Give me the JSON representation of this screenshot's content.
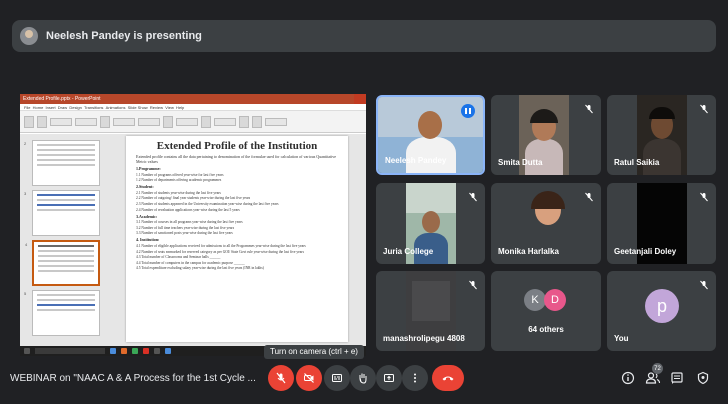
{
  "banner": {
    "presenting_text": "Neelesh Pandey is presenting"
  },
  "presentation": {
    "window_title": "Extended Profile.pptx - PowerPoint",
    "slide": {
      "title": "Extended Profile of the Institution",
      "intro": "Extended profile contains all the data pertaining to denomination of the formulae used for calculation of various Quantitative Metric values",
      "sections": [
        {
          "heading": "1.Programme:",
          "lines": [
            "1.1 Number of programs offered year-wise for last five years",
            "1.2 Number of departments offering academic programmes"
          ]
        },
        {
          "heading": "2.Student:",
          "lines": [
            "2.1 Number of students year-wise during the last five years",
            "2.2 Number of outgoing/ final year students year-wise during the last five years",
            "2.3 Number of students appeared in the University examination year-wise during the last five years",
            "2.4 Number of revaluation applications year-wise during the last 5 years"
          ]
        },
        {
          "heading": "3.Academic:",
          "lines": [
            "3.1 Number of courses in all programs year-wise during the last five years",
            "3.2 Number of full time teachers year-wise during the last five years",
            "3.3 Number of sanctioned posts year-wise during the last five years"
          ]
        },
        {
          "heading": "4. Institution:",
          "lines": [
            "4.1 Number of eligible applications received for admissions to all the Programmes year-wise during the last five years",
            "4.2 Number of seats earmarked for reserved category as per GOI/ State Govt rule year-wise during the last five years",
            "4.3 Total number of Classrooms and Seminar halls ______",
            "4.4 Total number of computers in the campus for academic purpose ______",
            "4.5 Total expenditure excluding salary year-wise during the last five years (INR in lakhs)"
          ]
        }
      ]
    }
  },
  "participants": [
    {
      "name": "Neelesh Pandey",
      "speaking": true
    },
    {
      "name": "Smita Dutta",
      "muted": true
    },
    {
      "name": "Ratul Saikia",
      "muted": true
    },
    {
      "name": "Juria College",
      "muted": true
    },
    {
      "name": "Monika Harlalka",
      "muted": true
    },
    {
      "name": "Geetanjali Doley",
      "muted": true
    },
    {
      "name": "manashrolipegu 4808",
      "muted": true
    },
    {
      "name": "64 others",
      "initials": [
        "K",
        "D"
      ]
    },
    {
      "name": "You",
      "initial": "p",
      "muted": true
    }
  ],
  "tooltip": "Turn on camera (ctrl + e)",
  "bottom_bar": {
    "meeting_title": "WEBINAR on \"NAAC A & A Process for the 1st Cycle ...",
    "participant_count": "72"
  },
  "colors": {
    "background": "#202124",
    "tile": "#3c4043",
    "danger": "#ea4335",
    "accent": "#8ab4f8"
  },
  "icons": {
    "mic_off": "mic-off-icon",
    "camera_off": "camera-off-icon",
    "captions": "captions-icon",
    "hand": "raise-hand-icon",
    "present": "present-icon",
    "more": "more-options-icon",
    "end_call": "end-call-icon",
    "info": "info-icon",
    "people": "people-icon",
    "chat": "chat-icon",
    "activities": "activities-icon"
  }
}
